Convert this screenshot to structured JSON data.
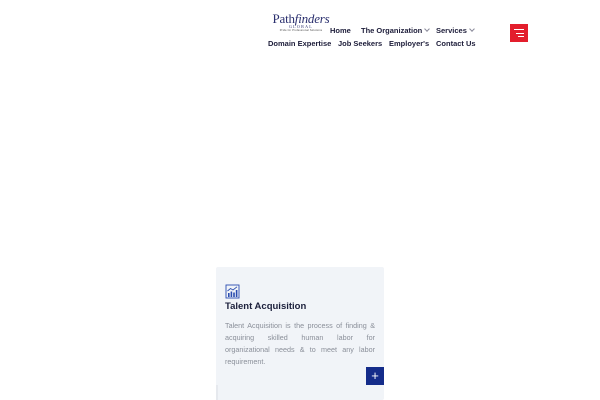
{
  "logo": {
    "name_part1": "Path",
    "name_part2": "finders",
    "sub": "GLOBAL",
    "tagline": "Pride for Professional Solutions"
  },
  "nav": {
    "row1": [
      {
        "label": "Home",
        "has_dropdown": false
      },
      {
        "label": "The Organization",
        "has_dropdown": true
      },
      {
        "label": "Services",
        "has_dropdown": true
      }
    ],
    "row2": [
      {
        "label": "Domain Expertise"
      },
      {
        "label": "Job Seekers"
      },
      {
        "label": "Employer's"
      },
      {
        "label": "Contact Us"
      }
    ]
  },
  "menu_button": {
    "icon": "hamburger-menu-icon",
    "color": "#e31e2c"
  },
  "card": {
    "icon": "growth-chart-icon",
    "title": "Talent Acquisition",
    "description": "Talent Acquisition is the process of finding & acquiring skilled human labor for organizational needs & to meet any labor requirement.",
    "button_label": "+",
    "button_color": "#142c8a"
  }
}
